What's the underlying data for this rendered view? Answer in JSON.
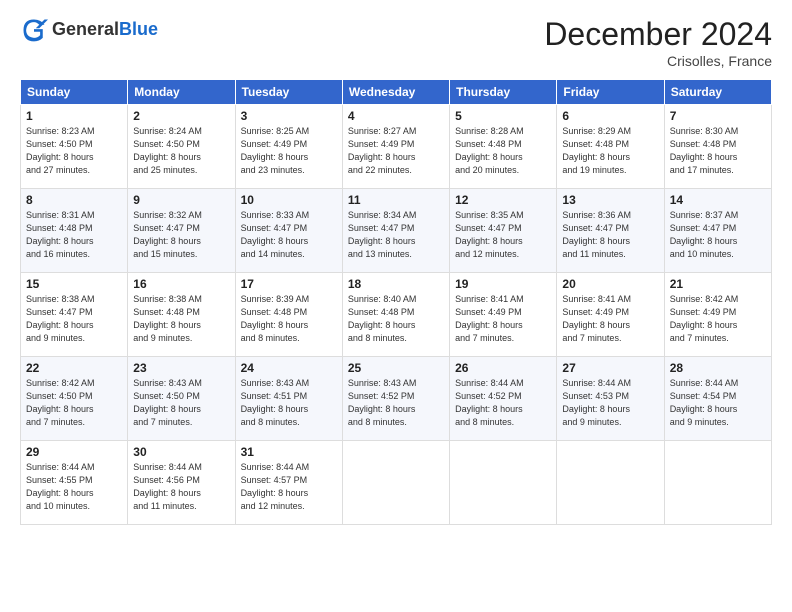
{
  "logo": {
    "general": "General",
    "blue": "Blue"
  },
  "title": "December 2024",
  "subtitle": "Crisolles, France",
  "days_header": [
    "Sunday",
    "Monday",
    "Tuesday",
    "Wednesday",
    "Thursday",
    "Friday",
    "Saturday"
  ],
  "weeks": [
    [
      {
        "day": "1",
        "info": "Sunrise: 8:23 AM\nSunset: 4:50 PM\nDaylight: 8 hours\nand 27 minutes."
      },
      {
        "day": "2",
        "info": "Sunrise: 8:24 AM\nSunset: 4:50 PM\nDaylight: 8 hours\nand 25 minutes."
      },
      {
        "day": "3",
        "info": "Sunrise: 8:25 AM\nSunset: 4:49 PM\nDaylight: 8 hours\nand 23 minutes."
      },
      {
        "day": "4",
        "info": "Sunrise: 8:27 AM\nSunset: 4:49 PM\nDaylight: 8 hours\nand 22 minutes."
      },
      {
        "day": "5",
        "info": "Sunrise: 8:28 AM\nSunset: 4:48 PM\nDaylight: 8 hours\nand 20 minutes."
      },
      {
        "day": "6",
        "info": "Sunrise: 8:29 AM\nSunset: 4:48 PM\nDaylight: 8 hours\nand 19 minutes."
      },
      {
        "day": "7",
        "info": "Sunrise: 8:30 AM\nSunset: 4:48 PM\nDaylight: 8 hours\nand 17 minutes."
      }
    ],
    [
      {
        "day": "8",
        "info": "Sunrise: 8:31 AM\nSunset: 4:48 PM\nDaylight: 8 hours\nand 16 minutes."
      },
      {
        "day": "9",
        "info": "Sunrise: 8:32 AM\nSunset: 4:47 PM\nDaylight: 8 hours\nand 15 minutes."
      },
      {
        "day": "10",
        "info": "Sunrise: 8:33 AM\nSunset: 4:47 PM\nDaylight: 8 hours\nand 14 minutes."
      },
      {
        "day": "11",
        "info": "Sunrise: 8:34 AM\nSunset: 4:47 PM\nDaylight: 8 hours\nand 13 minutes."
      },
      {
        "day": "12",
        "info": "Sunrise: 8:35 AM\nSunset: 4:47 PM\nDaylight: 8 hours\nand 12 minutes."
      },
      {
        "day": "13",
        "info": "Sunrise: 8:36 AM\nSunset: 4:47 PM\nDaylight: 8 hours\nand 11 minutes."
      },
      {
        "day": "14",
        "info": "Sunrise: 8:37 AM\nSunset: 4:47 PM\nDaylight: 8 hours\nand 10 minutes."
      }
    ],
    [
      {
        "day": "15",
        "info": "Sunrise: 8:38 AM\nSunset: 4:47 PM\nDaylight: 8 hours\nand 9 minutes."
      },
      {
        "day": "16",
        "info": "Sunrise: 8:38 AM\nSunset: 4:48 PM\nDaylight: 8 hours\nand 9 minutes."
      },
      {
        "day": "17",
        "info": "Sunrise: 8:39 AM\nSunset: 4:48 PM\nDaylight: 8 hours\nand 8 minutes."
      },
      {
        "day": "18",
        "info": "Sunrise: 8:40 AM\nSunset: 4:48 PM\nDaylight: 8 hours\nand 8 minutes."
      },
      {
        "day": "19",
        "info": "Sunrise: 8:41 AM\nSunset: 4:49 PM\nDaylight: 8 hours\nand 7 minutes."
      },
      {
        "day": "20",
        "info": "Sunrise: 8:41 AM\nSunset: 4:49 PM\nDaylight: 8 hours\nand 7 minutes."
      },
      {
        "day": "21",
        "info": "Sunrise: 8:42 AM\nSunset: 4:49 PM\nDaylight: 8 hours\nand 7 minutes."
      }
    ],
    [
      {
        "day": "22",
        "info": "Sunrise: 8:42 AM\nSunset: 4:50 PM\nDaylight: 8 hours\nand 7 minutes."
      },
      {
        "day": "23",
        "info": "Sunrise: 8:43 AM\nSunset: 4:50 PM\nDaylight: 8 hours\nand 7 minutes."
      },
      {
        "day": "24",
        "info": "Sunrise: 8:43 AM\nSunset: 4:51 PM\nDaylight: 8 hours\nand 8 minutes."
      },
      {
        "day": "25",
        "info": "Sunrise: 8:43 AM\nSunset: 4:52 PM\nDaylight: 8 hours\nand 8 minutes."
      },
      {
        "day": "26",
        "info": "Sunrise: 8:44 AM\nSunset: 4:52 PM\nDaylight: 8 hours\nand 8 minutes."
      },
      {
        "day": "27",
        "info": "Sunrise: 8:44 AM\nSunset: 4:53 PM\nDaylight: 8 hours\nand 9 minutes."
      },
      {
        "day": "28",
        "info": "Sunrise: 8:44 AM\nSunset: 4:54 PM\nDaylight: 8 hours\nand 9 minutes."
      }
    ],
    [
      {
        "day": "29",
        "info": "Sunrise: 8:44 AM\nSunset: 4:55 PM\nDaylight: 8 hours\nand 10 minutes."
      },
      {
        "day": "30",
        "info": "Sunrise: 8:44 AM\nSunset: 4:56 PM\nDaylight: 8 hours\nand 11 minutes."
      },
      {
        "day": "31",
        "info": "Sunrise: 8:44 AM\nSunset: 4:57 PM\nDaylight: 8 hours\nand 12 minutes."
      },
      null,
      null,
      null,
      null
    ]
  ]
}
